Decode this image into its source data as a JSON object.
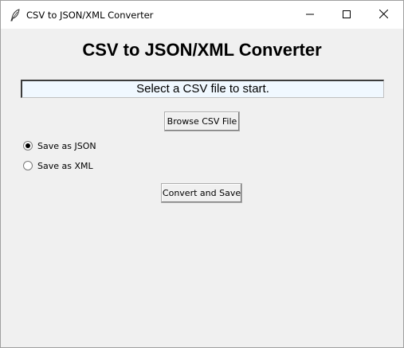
{
  "window": {
    "title": "CSV to JSON/XML Converter",
    "icon": "feather-icon",
    "controls": [
      "minimize-icon",
      "maximize-icon",
      "close-icon"
    ]
  },
  "main": {
    "heading": "CSV to JSON/XML Converter",
    "status_text": "Select a CSV file to start.",
    "browse_label": "Browse CSV File",
    "options": [
      {
        "label": "Save as JSON",
        "selected": true
      },
      {
        "label": "Save as XML",
        "selected": false
      }
    ],
    "convert_label": "Convert and Save"
  },
  "colors": {
    "window_bg": "#f0f0f0",
    "status_bg": "#f0f8ff"
  }
}
